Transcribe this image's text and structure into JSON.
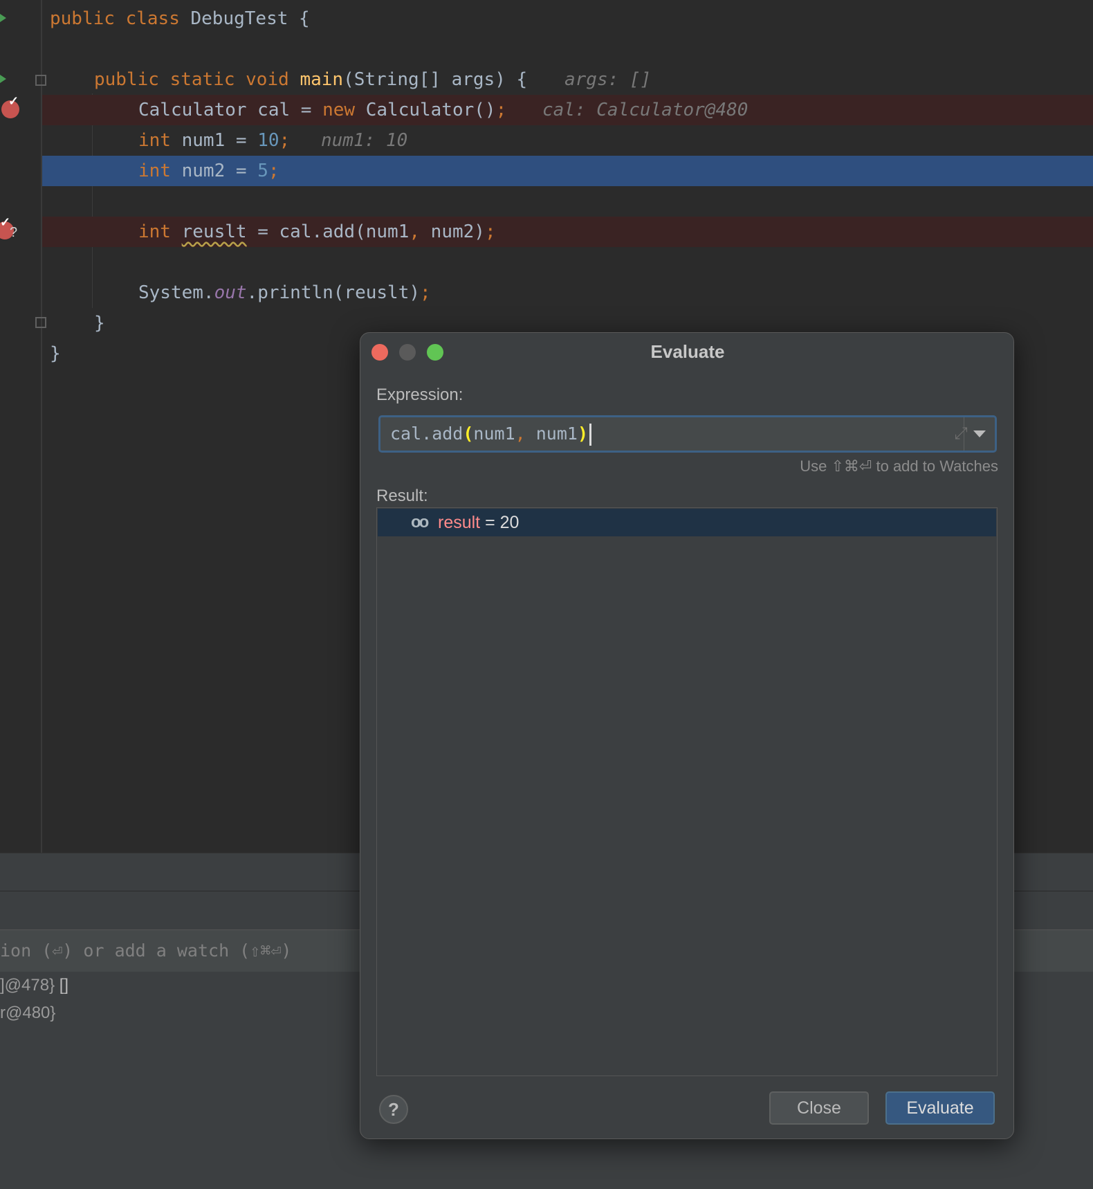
{
  "editor": {
    "lines": [
      {
        "p1": "public ",
        "p2": "class ",
        "p3": "DebugTest {"
      },
      {
        "p1": "public ",
        "p2": "static ",
        "p3": "void ",
        "p4": "main",
        "p5": "(String[] args) {",
        "hint": "args: []"
      },
      {
        "p1": "Calculator cal = ",
        "p2": "new ",
        "p3": "Calculator()",
        "p4": ";",
        "hint": "cal: Calculator@480"
      },
      {
        "p1": "int ",
        "p2": "num1 = ",
        "p3": "10",
        "p4": ";",
        "hint": "num1: 10"
      },
      {
        "p1": "int ",
        "p2": "num2 = ",
        "p3": "5",
        "p4": ";"
      },
      {
        "p1": "int ",
        "p2": "reuslt",
        "p3": " = cal.add(num1",
        "p4": ", ",
        "p5": "num2)",
        "p6": ";"
      },
      {
        "p1": "System.",
        "p2": "out",
        "p3": ".println(reuslt)",
        "p4": ";"
      },
      {
        "p1": "}"
      },
      {
        "p1": "}"
      }
    ]
  },
  "watches": {
    "placeholder": "ion (⏎) or add a watch (⇧⌘⏎)"
  },
  "variables": [
    {
      "a": "]@478}",
      "b": " []"
    },
    {
      "a": "r@480}",
      "b": ""
    }
  ],
  "dialog": {
    "title": "Evaluate",
    "expression_label": "Expression:",
    "expression": {
      "p1": "cal.add",
      "p2": "(",
      "p3": "num1",
      "p4": ", ",
      "p5": "num1",
      "p6": ")"
    },
    "watch_hint": "Use ⇧⌘⏎ to add to Watches",
    "result_label": "Result:",
    "result": {
      "name": "result",
      "rest": " = 20"
    },
    "help_label": "?",
    "close_label": "Close",
    "evaluate_label": "Evaluate"
  }
}
